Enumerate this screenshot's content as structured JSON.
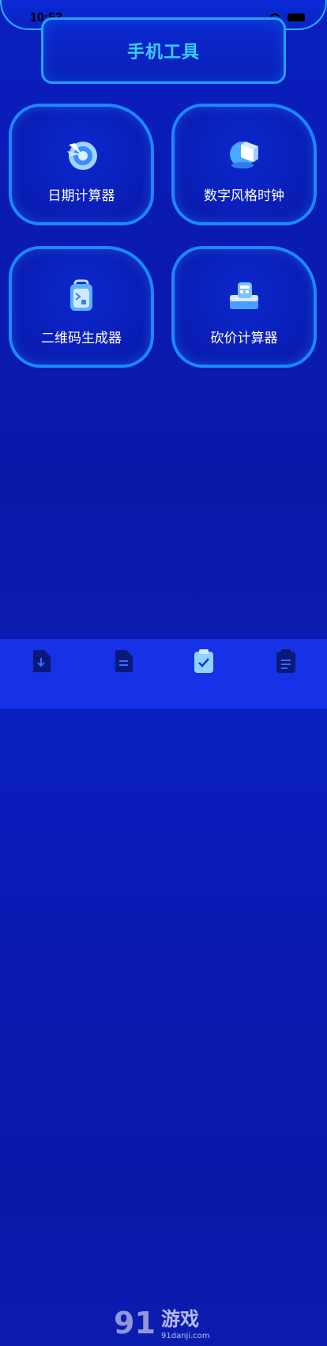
{
  "status": {
    "time": "10:53"
  },
  "header": {
    "title": "手机工具"
  },
  "tools": [
    {
      "label": "日期计算器",
      "icon": "target-dart-icon"
    },
    {
      "label": "数字风格时钟",
      "icon": "cube-box-icon"
    },
    {
      "label": "二维码生成器",
      "icon": "backpack-icon"
    },
    {
      "label": "砍价计算器",
      "icon": "calculator-stack-icon"
    }
  ],
  "tabs": [
    {
      "name": "download-doc-icon",
      "active": false
    },
    {
      "name": "document-icon",
      "active": false
    },
    {
      "name": "clipboard-check-icon",
      "active": true
    },
    {
      "name": "clipboard-list-icon",
      "active": false
    }
  ],
  "watermark": {
    "brand": "91游戏",
    "site": "91danji.com"
  },
  "colors": {
    "accent": "#1b88ff",
    "title": "#35d0ff",
    "tabbar": "#1731e6"
  }
}
